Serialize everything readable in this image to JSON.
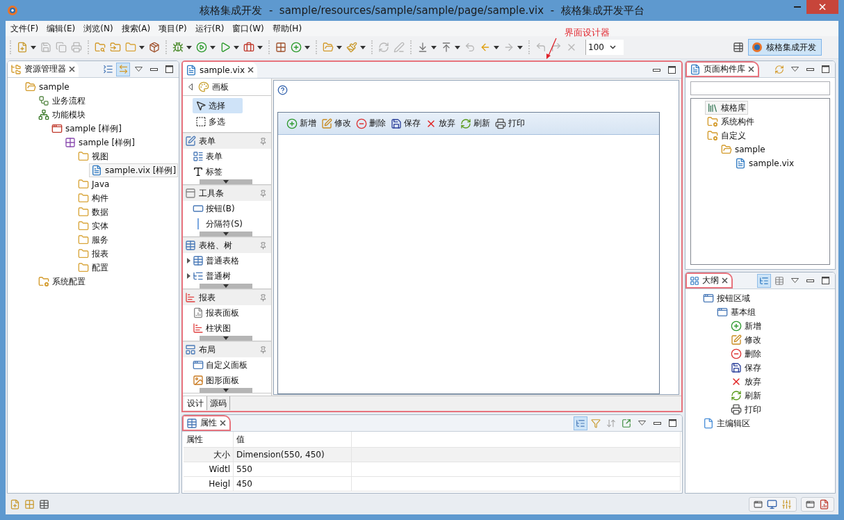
{
  "window": {
    "title": "核格集成开发  -  sample/resources/sample/sample/page/sample.vix  -  核格集成开发平台"
  },
  "menu": [
    "文件(F)",
    "编辑(E)",
    "浏览(N)",
    "搜索(A)",
    "项目(P)",
    "运行(R)",
    "窗口(W)",
    "帮助(H)"
  ],
  "toolbar": {
    "groups": [
      [
        {
          "kind": "new",
          "menu": true,
          "disabled": false
        },
        {
          "kind": "save",
          "menu": false,
          "disabled": true
        },
        {
          "kind": "save-all",
          "menu": false,
          "disabled": true
        },
        {
          "kind": "print",
          "menu": false,
          "disabled": true
        }
      ],
      [
        {
          "kind": "open-search",
          "menu": false,
          "disabled": false
        },
        {
          "kind": "import",
          "menu": false,
          "disabled": false
        },
        {
          "kind": "folder",
          "menu": true,
          "disabled": false
        },
        {
          "kind": "package",
          "menu": false,
          "disabled": false
        }
      ],
      [
        {
          "kind": "debug",
          "menu": true,
          "disabled": false
        },
        {
          "kind": "run",
          "menu": true,
          "disabled": false
        },
        {
          "kind": "run-config",
          "menu": true,
          "disabled": false
        },
        {
          "kind": "external",
          "menu": true,
          "disabled": false
        }
      ],
      [
        {
          "kind": "new-component",
          "menu": false,
          "disabled": false
        },
        {
          "kind": "new-class",
          "menu": true,
          "disabled": false
        }
      ],
      [
        {
          "kind": "open-type",
          "menu": true,
          "disabled": false
        },
        {
          "kind": "brush",
          "menu": true,
          "disabled": false
        }
      ],
      [
        {
          "kind": "sync",
          "menu": false,
          "disabled": true
        },
        {
          "kind": "pen",
          "menu": false,
          "disabled": true
        }
      ],
      [
        {
          "kind": "next",
          "menu": true,
          "disabled": false
        },
        {
          "kind": "prev",
          "menu": true,
          "disabled": false
        },
        {
          "kind": "last-edit",
          "menu": false,
          "disabled": true
        },
        {
          "kind": "back",
          "menu": true,
          "disabled": false
        },
        {
          "kind": "forward",
          "menu": true,
          "disabled": true
        }
      ],
      [
        {
          "kind": "undo",
          "menu": false,
          "disabled": true
        },
        {
          "kind": "redo",
          "menu": false,
          "disabled": true
        },
        {
          "kind": "remove",
          "menu": false,
          "disabled": true
        }
      ]
    ],
    "zoom": "100",
    "perspective": {
      "label": "核格集成开发",
      "selected": true
    }
  },
  "annotation": {
    "text": "界面设计器"
  },
  "explorer": {
    "title": "资源管理器",
    "link_selected": true,
    "tree": [
      {
        "label": "sample",
        "kind": "project",
        "selected": false,
        "children": [
          {
            "label": "业务流程",
            "kind": "flow",
            "selected": false
          },
          {
            "label": "功能模块",
            "kind": "module",
            "selected": false,
            "children": [
              {
                "label": "sample [样例]",
                "kind": "module-item",
                "selected": false,
                "children": [
                  {
                    "label": "sample [样例]",
                    "kind": "component",
                    "selected": false,
                    "children": [
                      {
                        "label": "视图",
                        "kind": "folder",
                        "selected": false,
                        "children": [
                          {
                            "label": "sample.vix [样例]",
                            "kind": "file",
                            "selected": true
                          }
                        ]
                      },
                      {
                        "label": "Java",
                        "kind": "folder",
                        "selected": false
                      },
                      {
                        "label": "构件",
                        "kind": "folder",
                        "selected": false
                      },
                      {
                        "label": "数据",
                        "kind": "folder",
                        "selected": false
                      },
                      {
                        "label": "实体",
                        "kind": "folder",
                        "selected": false
                      },
                      {
                        "label": "服务",
                        "kind": "folder",
                        "selected": false
                      },
                      {
                        "label": "报表",
                        "kind": "folder",
                        "selected": false
                      },
                      {
                        "label": "配置",
                        "kind": "folder",
                        "selected": false
                      }
                    ]
                  }
                ]
              }
            ]
          },
          {
            "label": "系统配置",
            "kind": "config",
            "selected": false
          }
        ]
      }
    ]
  },
  "editor": {
    "tab": "sample.vix",
    "highlighted": true,
    "palette": {
      "title": "画板",
      "tools": [
        {
          "label": "选择",
          "kind": "select",
          "selected": true
        },
        {
          "label": "多选",
          "kind": "multi",
          "selected": false
        }
      ],
      "groups": [
        {
          "title": "表单",
          "kind": "form",
          "items": [
            {
              "label": "表单",
              "kind": "form-item",
              "expandable": false
            },
            {
              "label": "标签",
              "kind": "label",
              "expandable": false
            }
          ]
        },
        {
          "title": "工具条",
          "kind": "toolbar",
          "items": [
            {
              "label": "按钮(B)",
              "kind": "button",
              "expandable": false
            },
            {
              "label": "分隔符(S)",
              "kind": "separator",
              "expandable": false
            }
          ]
        },
        {
          "title": "表格、树",
          "kind": "table",
          "items": [
            {
              "label": "普通表格",
              "kind": "table",
              "expandable": true
            },
            {
              "label": "普通树",
              "kind": "tree",
              "expandable": true
            }
          ]
        },
        {
          "title": "报表",
          "kind": "report",
          "items": [
            {
              "label": "报表面板",
              "kind": "report-panel",
              "expandable": false
            },
            {
              "label": "柱状图",
              "kind": "report",
              "expandable": false
            }
          ]
        },
        {
          "title": "布局",
          "kind": "layout",
          "items": [
            {
              "label": "自定义面板",
              "kind": "custom-panel",
              "expandable": false
            },
            {
              "label": "图形面板",
              "kind": "image-panel",
              "expandable": false
            }
          ]
        }
      ]
    },
    "form_buttons": [
      {
        "label": "新增",
        "kind": "add"
      },
      {
        "label": "修改",
        "kind": "edit"
      },
      {
        "label": "删除",
        "kind": "delete"
      },
      {
        "label": "保存",
        "kind": "save-blue"
      },
      {
        "label": "放弃",
        "kind": "cancel"
      },
      {
        "label": "刷新",
        "kind": "refresh"
      },
      {
        "label": "打印",
        "kind": "printer"
      }
    ],
    "bottom_tabs": [
      {
        "label": "设计",
        "selected": true
      },
      {
        "label": "源码",
        "selected": false
      }
    ]
  },
  "properties": {
    "title": "属性",
    "highlighted": true,
    "categories_selected": true,
    "columns": [
      "属性",
      "值"
    ],
    "rows": [
      {
        "name": "大小",
        "value": "Dimension(550, 450)",
        "children": [
          {
            "name": "Widtl",
            "value": "550"
          },
          {
            "name": "Heigl",
            "value": "450"
          }
        ]
      }
    ]
  },
  "library": {
    "title": "页面构件库",
    "highlighted": true,
    "tree": [
      {
        "label": "核格库",
        "kind": "library",
        "selected": true
      },
      {
        "label": "系统构件",
        "kind": "config",
        "selected": false
      },
      {
        "label": "自定义",
        "kind": "config",
        "selected": false,
        "children": [
          {
            "label": "sample",
            "kind": "project",
            "selected": false,
            "children": [
              {
                "label": "sample.vix",
                "kind": "file",
                "selected": false
              }
            ]
          }
        ]
      }
    ]
  },
  "outline": {
    "title": "大纲",
    "highlighted": true,
    "tree_selected": true,
    "tree": [
      {
        "label": "按钮区域",
        "kind": "window",
        "selected": false,
        "children": [
          {
            "label": "基本组",
            "kind": "window",
            "selected": false,
            "children": [
              {
                "label": "新增",
                "kind": "add",
                "selected": false
              },
              {
                "label": "修改",
                "kind": "edit",
                "selected": false
              },
              {
                "label": "删除",
                "kind": "delete",
                "selected": false
              },
              {
                "label": "保存",
                "kind": "save-blue",
                "selected": false
              },
              {
                "label": "放弃",
                "kind": "cancel",
                "selected": false
              },
              {
                "label": "刷新",
                "kind": "refresh",
                "selected": false
              },
              {
                "label": "打印",
                "kind": "printer",
                "selected": false
              }
            ]
          }
        ]
      },
      {
        "label": "主编辑区",
        "kind": "doc",
        "selected": false
      }
    ]
  }
}
